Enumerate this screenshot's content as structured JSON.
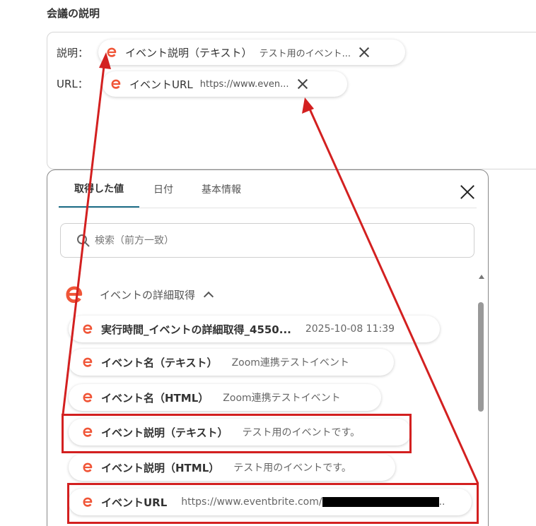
{
  "section": {
    "title": "会議の説明"
  },
  "field": {
    "rows": [
      {
        "label": "説明：",
        "chip_name": "イベント説明（テキスト）",
        "chip_value": "テスト用のイベント..."
      },
      {
        "label": "URL：",
        "chip_name": "イベントURL",
        "chip_value": "https://www.even..."
      }
    ]
  },
  "panel": {
    "tabs": [
      "取得した値",
      "日付",
      "基本情報"
    ],
    "search_placeholder": "検索（前方一致）",
    "group_title": "イベントの詳細取得",
    "items": [
      {
        "name": "実行時間_イベントの詳細取得_4550...",
        "value": "2025-10-08 11:39"
      },
      {
        "name": "イベント名（テキスト）",
        "value": "Zoom連携テストイベント"
      },
      {
        "name": "イベント名（HTML）",
        "value": "Zoom連携テストイベント"
      },
      {
        "name": "イベント説明（テキスト）",
        "value": "テスト用のイベントです。"
      },
      {
        "name": "イベント説明（HTML）",
        "value": "テスト用のイベントです。"
      },
      {
        "name": "イベントURL",
        "value": "https://www.eventbrite.com/",
        "value_suffix": ".."
      }
    ]
  },
  "colors": {
    "brand_orange": "#f05537",
    "accent_teal": "#1f6f89",
    "annotation_red": "#d32020"
  },
  "icons": {
    "service": "eventbrite-e-icon",
    "remove": "close-icon",
    "search": "search-icon"
  }
}
